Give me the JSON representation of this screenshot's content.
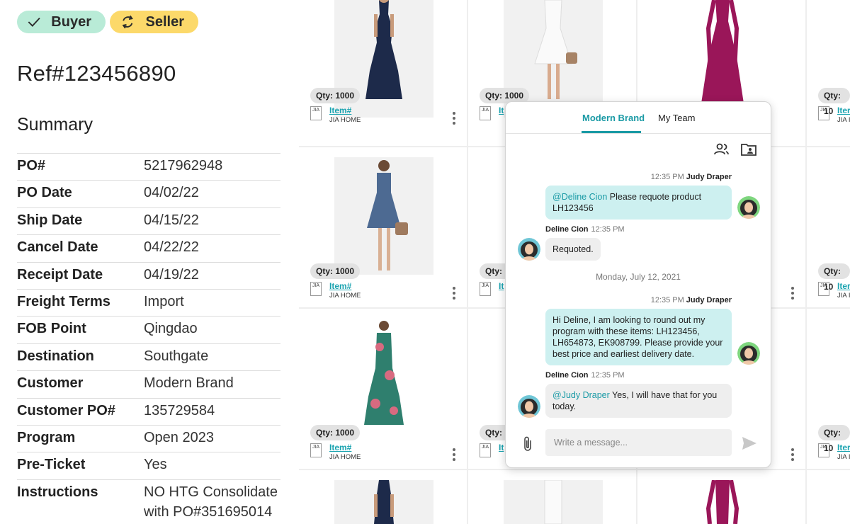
{
  "roles": {
    "buyer": "Buyer",
    "seller": "Seller"
  },
  "reference": "Ref#123456890",
  "summary": {
    "title": "Summary",
    "rows": [
      {
        "label": "PO#",
        "value": "5217962948"
      },
      {
        "label": "PO Date",
        "value": "04/02/22"
      },
      {
        "label": "Ship Date",
        "value": "04/15/22"
      },
      {
        "label": "Cancel Date",
        "value": "04/22/22"
      },
      {
        "label": "Receipt Date",
        "value": "04/19/22"
      },
      {
        "label": "Freight Terms",
        "value": "Import"
      },
      {
        "label": "FOB Point",
        "value": "Qingdao"
      },
      {
        "label": "Destination",
        "value": "Southgate"
      },
      {
        "label": "Customer",
        "value": "Modern Brand"
      },
      {
        "label": "Customer PO#",
        "value": "135729584"
      },
      {
        "label": "Program",
        "value": "Open 2023"
      },
      {
        "label": "Pre-Ticket",
        "value": "Yes"
      },
      {
        "label": "Instructions",
        "value": "NO HTG Consolidate with PO#351695014"
      }
    ]
  },
  "products": {
    "qty": "Qty: 1000",
    "qty_partial": "Qty: 10",
    "item_link": "Item#",
    "item_link_partial": "It",
    "item_link_partial_right": "Iter",
    "brand": "JIA HOME",
    "brand_partial": "JIA I",
    "logo_text": "JIA"
  },
  "chat": {
    "tabs": [
      "Modern Brand",
      "My Team"
    ],
    "messages": [
      {
        "time": "12:35 PM",
        "author": "Judy Draper",
        "mention": "@Deline Cion",
        "text": " Please requote product LH123456"
      },
      {
        "time": "12:35 PM",
        "author": "Deline Cion",
        "text": "Requoted."
      },
      {
        "time": "12:35 PM",
        "author": "Judy Draper",
        "text": "Hi Deline, I am looking to round out my program with these items: LH123456, LH654873, EK908799. Please provide your best price and earliest delivery date."
      },
      {
        "time": "12:35 PM",
        "author": "Deline Cion",
        "mention": "@Judy Draper",
        "text": " Yes, I will have that for you today."
      }
    ],
    "day_separator": "Monday, July 12, 2021",
    "input_placeholder": "Write a message..."
  },
  "colors": {
    "accent": "#1a9aa5",
    "buyer_pill": "#b9ebd7",
    "seller_pill": "#fcd96a",
    "outgoing_bubble": "#cdf0f0",
    "incoming_bubble": "#eeeeee"
  }
}
